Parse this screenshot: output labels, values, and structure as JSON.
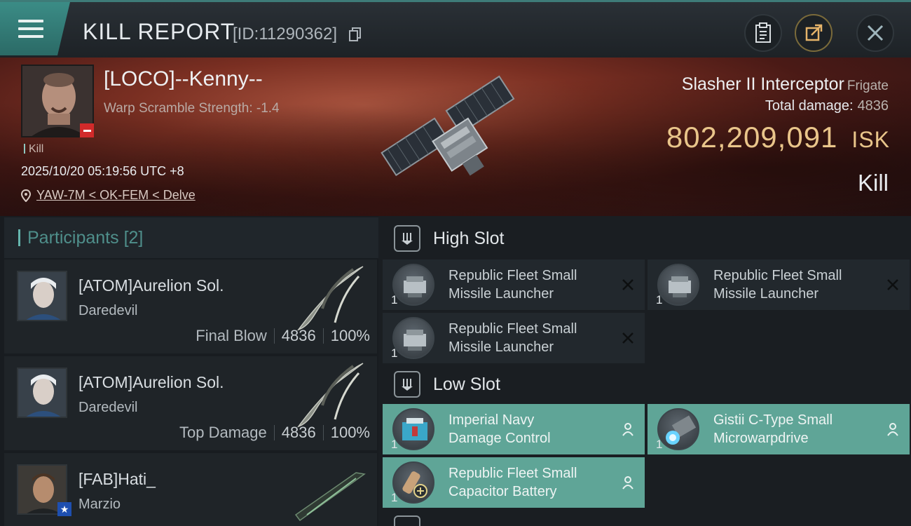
{
  "header": {
    "title": "KILL REPORT",
    "report_id": "[ID:11290362]"
  },
  "victim": {
    "name": "[LOCO]--Kenny--",
    "warp_scramble": "Warp Scramble Strength: -1.4",
    "kill_tag": "Kill",
    "datetime": "2025/10/20 05:19:56 UTC +8",
    "location": "YAW-7M < OK-FEM < Delve",
    "ship_name": "Slasher II Interceptor",
    "ship_class": "Frigate",
    "total_damage_label": "Total damage:",
    "total_damage": "4836",
    "isk_value": "802,209,091",
    "isk_unit": "ISK",
    "result": "Kill"
  },
  "participants": {
    "title": "Participants",
    "count": "[2]",
    "rows": [
      {
        "name": "[ATOM]Aurelion Sol.",
        "ship": "Daredevil",
        "role": "Final Blow",
        "damage": "4836",
        "percent": "100%"
      },
      {
        "name": "[ATOM]Aurelion Sol.",
        "ship": "Daredevil",
        "role": "Top Damage",
        "damage": "4836",
        "percent": "100%"
      },
      {
        "name": "[FAB]Hati_",
        "ship": "Marzio"
      }
    ]
  },
  "slots": {
    "high": {
      "title": "High Slot",
      "modules": [
        {
          "name_line1": "Republic Fleet Small",
          "name_line2": "Missile Launcher",
          "qty": "1",
          "state": "destroyed"
        },
        {
          "name_line1": "Republic Fleet Small",
          "name_line2": "Missile Launcher",
          "qty": "1",
          "state": "destroyed"
        },
        {
          "name_line1": "Republic Fleet Small",
          "name_line2": "Missile Launcher",
          "qty": "1",
          "state": "destroyed"
        }
      ]
    },
    "low": {
      "title": "Low Slot",
      "modules": [
        {
          "name_line1": "Imperial Navy",
          "name_line2": "Damage Control",
          "qty": "1",
          "state": "dropped"
        },
        {
          "name_line1": "Gistii C-Type Small",
          "name_line2": "Microwarpdrive",
          "qty": "1",
          "state": "dropped"
        },
        {
          "name_line1": "Republic Fleet Small",
          "name_line2": "Capacitor Battery",
          "qty": "1",
          "state": "dropped"
        }
      ]
    }
  },
  "colors": {
    "accent": "#5fa597",
    "isk": "#e9c58a",
    "badge_red": "#d22a2a"
  }
}
